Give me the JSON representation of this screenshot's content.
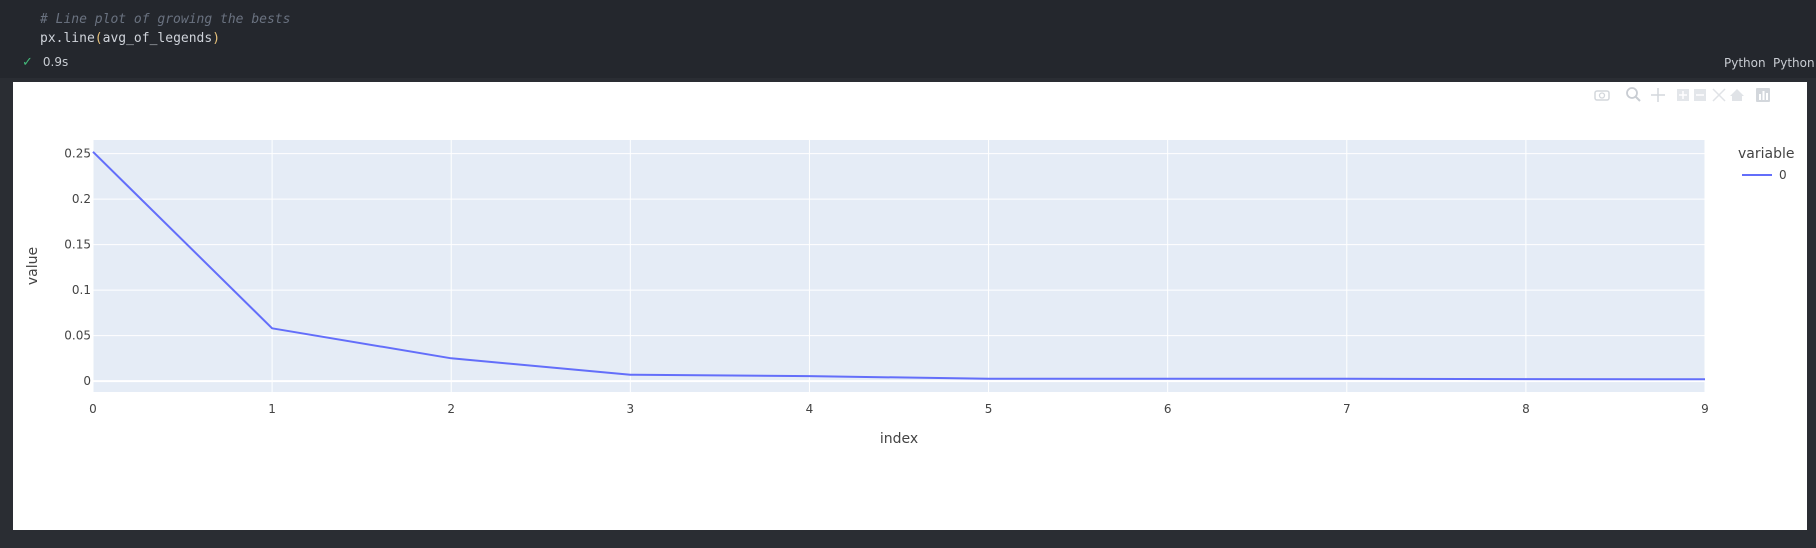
{
  "cell": {
    "comment": "# Line plot of growing the bests",
    "code_fn": "px.line",
    "code_open": "(",
    "code_arg": "avg_of_legends",
    "code_close": ")",
    "status_icon": "check-icon",
    "duration": "0.9s",
    "kernel_label_1": "Python",
    "kernel_label_2": "Python"
  },
  "toolbar": {
    "icons": [
      "camera-icon",
      "zoom-icon",
      "pan-icon",
      "zoom-in-icon",
      "zoom-out-icon",
      "autoscale-icon",
      "home-icon",
      "plotly-logo-icon"
    ]
  },
  "chart_data": {
    "type": "line",
    "xlabel": "index",
    "ylabel": "value",
    "legend_title": "variable",
    "legend_position": "top-right",
    "x": [
      0,
      1,
      2,
      3,
      4,
      5,
      6,
      7,
      8,
      9
    ],
    "series": [
      {
        "name": "0",
        "color": "#636efa",
        "values": [
          0.252,
          0.058,
          0.025,
          0.007,
          0.0055,
          0.0025,
          0.0025,
          0.0025,
          0.0022,
          0.002
        ]
      }
    ],
    "xlim": [
      0,
      9
    ],
    "ylim": [
      -0.012,
      0.265
    ],
    "xticks": [
      0,
      1,
      2,
      3,
      4,
      5,
      6,
      7,
      8,
      9
    ],
    "xtick_labels": [
      "0",
      "1",
      "2",
      "3",
      "4",
      "5",
      "6",
      "7",
      "8",
      "9"
    ],
    "yticks": [
      0,
      0.05,
      0.1,
      0.15,
      0.2,
      0.25
    ],
    "ytick_labels": [
      "0",
      "0.05",
      "0.1",
      "0.15",
      "0.2",
      "0.25"
    ],
    "grid": true,
    "plot_bg": "#e5ecf6"
  }
}
